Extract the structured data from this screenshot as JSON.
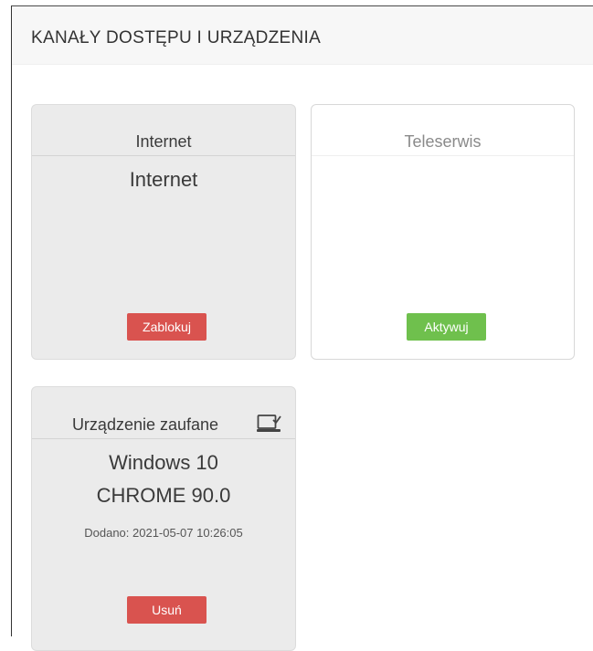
{
  "panel": {
    "title": "KANAŁY DOSTĘPU I URZĄDZENIA"
  },
  "channels": [
    {
      "title": "Internet",
      "value": "Internet",
      "button_label": "Zablokuj",
      "status": "active",
      "button_color": "#d9534f"
    },
    {
      "title": "Teleserwis",
      "button_label": "Aktywuj",
      "status": "inactive",
      "button_color": "#6fc04d"
    }
  ],
  "trusted_device": {
    "title": "Urządzenie zaufane",
    "icon": "trusted-device-icon",
    "os": "Windows 10",
    "browser": "CHROME 90.0",
    "added": "Dodano: 2021-05-07 10:26:05",
    "button_label": "Usuń",
    "button_color": "#d9534f"
  }
}
